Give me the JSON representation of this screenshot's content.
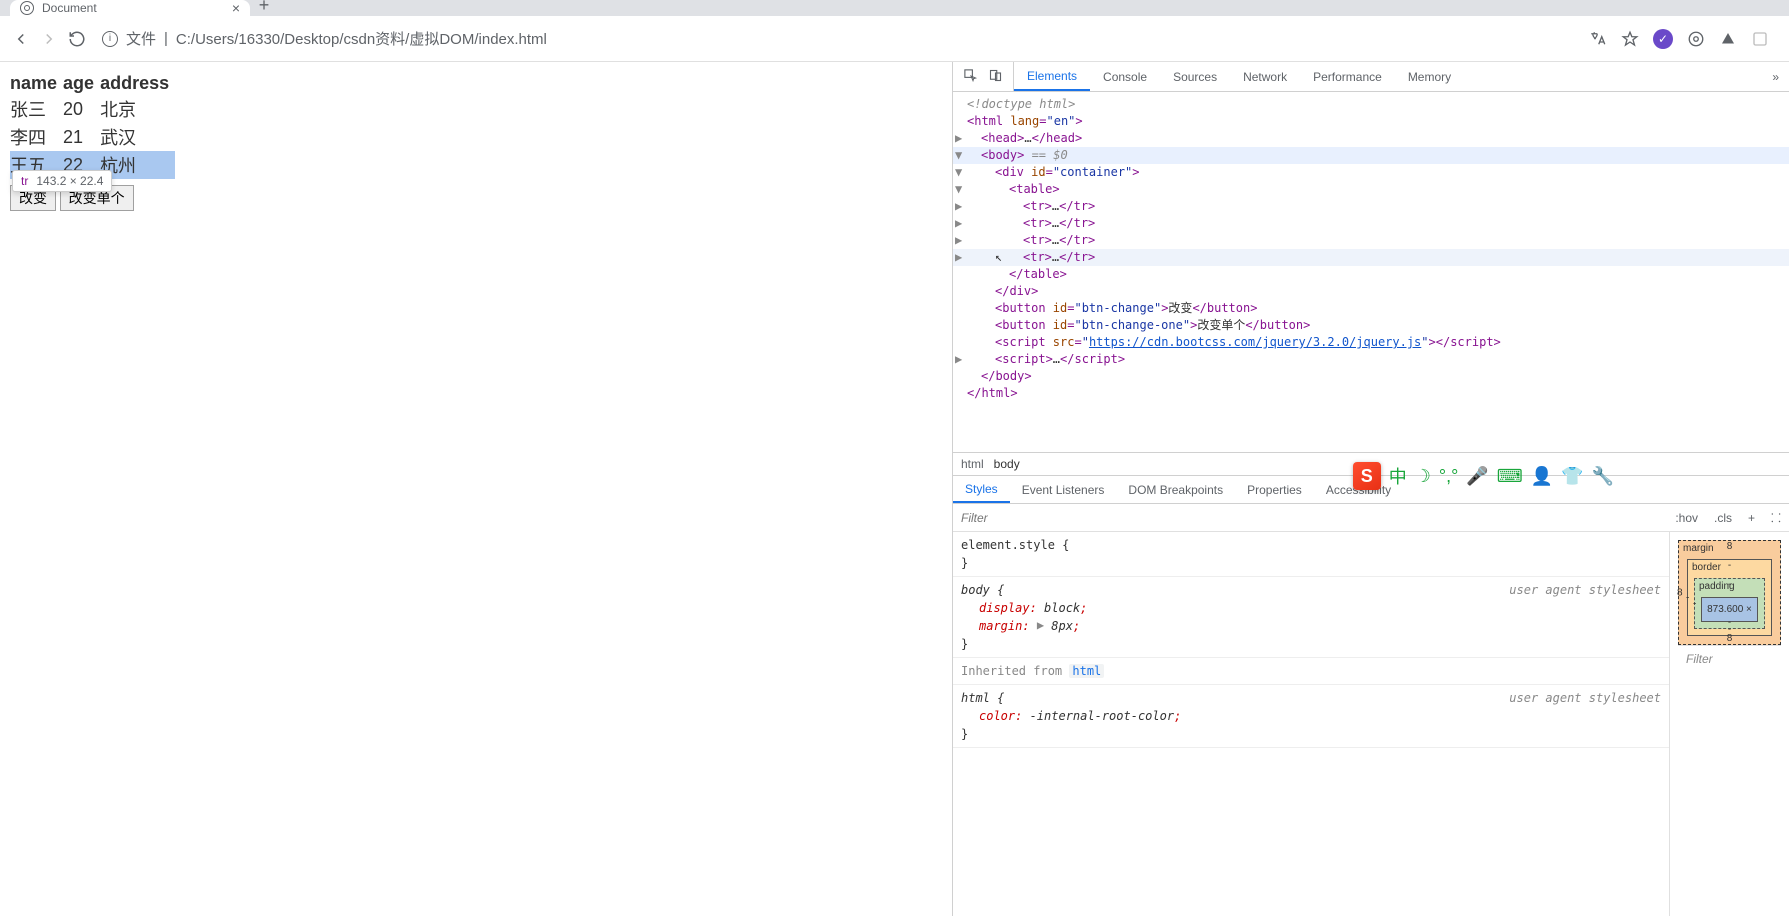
{
  "tab": {
    "title": "Document"
  },
  "toolbar": {
    "file_label": "文件",
    "url": "C:/Users/16330/Desktop/csdn资料/虚拟DOM/index.html"
  },
  "page": {
    "headers": [
      "name",
      "age",
      "address"
    ],
    "rows": [
      {
        "name": "张三",
        "age": "20",
        "city": "北京",
        "highlight": false
      },
      {
        "name": "李四",
        "age": "21",
        "city": "武汉",
        "highlight": false
      },
      {
        "name": "王五",
        "age": "22",
        "city": "杭州",
        "highlight": true
      }
    ],
    "btn1": "改变",
    "btn2": "改变单个"
  },
  "inspect_tip": {
    "tag": "tr",
    "dims": "143.2 × 22.4"
  },
  "devtools": {
    "tabs": [
      "Elements",
      "Console",
      "Sources",
      "Network",
      "Performance",
      "Memory"
    ],
    "active_tab": "Elements",
    "breadcrumb": [
      "html",
      "body"
    ],
    "styles_tabs": [
      "Styles",
      "Event Listeners",
      "DOM Breakpoints",
      "Properties",
      "Accessibility"
    ],
    "styles_active": "Styles",
    "filter_placeholder": "Filter",
    "hov_label": ":hov",
    "cls_label": ".cls",
    "rules": {
      "element_style": "element.style {",
      "body_sel": "body {",
      "body_display": "display",
      "body_display_v": "block",
      "body_margin": "margin",
      "body_margin_v": "8px",
      "ua": "user agent stylesheet",
      "inherited": "Inherited from ",
      "inherited_tag": "html",
      "html_sel": "html {",
      "html_color": "color",
      "html_color_v": "-internal-root-color"
    },
    "boxmodel": {
      "margin": "margin",
      "border": "border",
      "padding": "padding",
      "m_top": "8",
      "m_right": "",
      "m_bottom": "8",
      "m_left": "8",
      "b_top": "-",
      "b_left": "-",
      "p_top": "-",
      "p_left": "-",
      "content": "873.600 ×"
    },
    "computed_filter": "Filter"
  },
  "dom": {
    "doctype": "<!doctype html>",
    "html_open": "<html lang=\"en\">",
    "head": "<head>…</head>",
    "body_open": "<body>",
    "body_eq": " == $0",
    "container_open": "<div id=\"container\">",
    "table_open": "<table>",
    "tr": "<tr>…</tr>",
    "table_close": "</table>",
    "div_close": "</div>",
    "btn1": {
      "open": "<button id=\"btn-change\">",
      "text": "改变",
      "close": "</button>"
    },
    "btn2": {
      "open": "<button id=\"btn-change-one\">",
      "text": "改变单个",
      "close": "</button>"
    },
    "script_src_open": "<script src=\"",
    "script_src_url": "https://cdn.bootcss.com/jquery/3.2.0/jquery.js",
    "script_src_close": "\"></scr",
    "script2": "<scr",
    "script2b": "ipt>…</scr",
    "body_close": "</body>",
    "html_close": "</html>"
  },
  "ime": {
    "logo": "S",
    "lang": "中"
  }
}
